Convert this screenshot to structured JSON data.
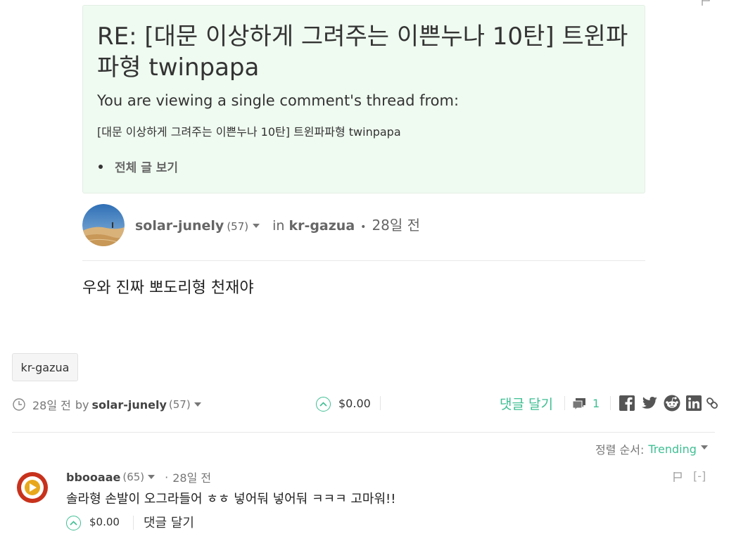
{
  "thread": {
    "title": "RE: [대문 이상하게 그려주는 이쁜누나 10탄] 트윈파파형 twinpapa",
    "viewing_text": "You are viewing a single comment's thread from:",
    "parent_link": "[대문 이상하게 그려주는 이쁜누나 10탄] 트윈파파형 twinpapa",
    "view_all_label": "전체 글 보기"
  },
  "post": {
    "author": "solar-junely",
    "reputation": "(57)",
    "in_label": "in",
    "community": "kr-gazua",
    "separator": "•",
    "time": "28일 전",
    "body": "우와 진짜 뽀도리형 천재야",
    "tag": "kr-gazua"
  },
  "footer": {
    "time": "28일 전",
    "by_label": "by",
    "author": "solar-junely",
    "reputation": "(57)",
    "payout": "$0.00",
    "reply_label": "댓글 달기",
    "comment_count": "1"
  },
  "sort": {
    "label": "정렬 순서:",
    "value": "Trending"
  },
  "reply": {
    "author": "bbooaae",
    "reputation": "(65)",
    "separator": "·",
    "time": "28일 전",
    "collapse_label": "[-]",
    "body": "솔라형 손발이 오그라들어 ㅎㅎ 넣어둬 넣어둬 ㅋㅋㅋ 고마워!!",
    "payout": "$0.00",
    "reply_label": "댓글 달기"
  },
  "colors": {
    "accent": "#3fbf93",
    "thread_bg": "#effaf0",
    "reply_avatar": "#c8321c"
  },
  "icons": [
    "flag-icon",
    "clock-icon",
    "upvote-icon",
    "comments-icon",
    "facebook-icon",
    "twitter-icon",
    "reddit-icon",
    "linkedin-icon",
    "link-icon"
  ]
}
